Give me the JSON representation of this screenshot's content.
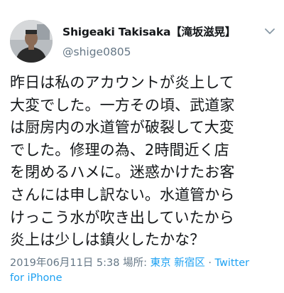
{
  "tweet": {
    "author": {
      "display_name": "Shigeaki Takisaka【滝坂滋晃】",
      "handle": "@shige0805",
      "avatar_icon": "user-avatar-photo"
    },
    "menu_icon": "chevron-down-icon",
    "text_lines": [
      "昨日は私のアカウントが炎上して",
      "大変でした。一方その頃、武道家",
      "は厨房内の水道管が破裂して大変",
      "でした。修理の為、2時間近く店",
      "を閉めるハメに。迷惑かけたお客",
      "さんには申し訳ない。水道管から",
      "けっこう水が吹き出していたから",
      "炎上は少しは鎮火したかな？"
    ],
    "meta": {
      "timestamp": "2019年06月11日 5:38",
      "location_label": "場所:",
      "location": "東京 新宿区",
      "separator": "·",
      "source_prefix": "Twitter",
      "source_suffix": "for iPhone"
    },
    "colors": {
      "text": "#14171a",
      "secondary": "#657786",
      "link": "#1da1f2"
    }
  }
}
